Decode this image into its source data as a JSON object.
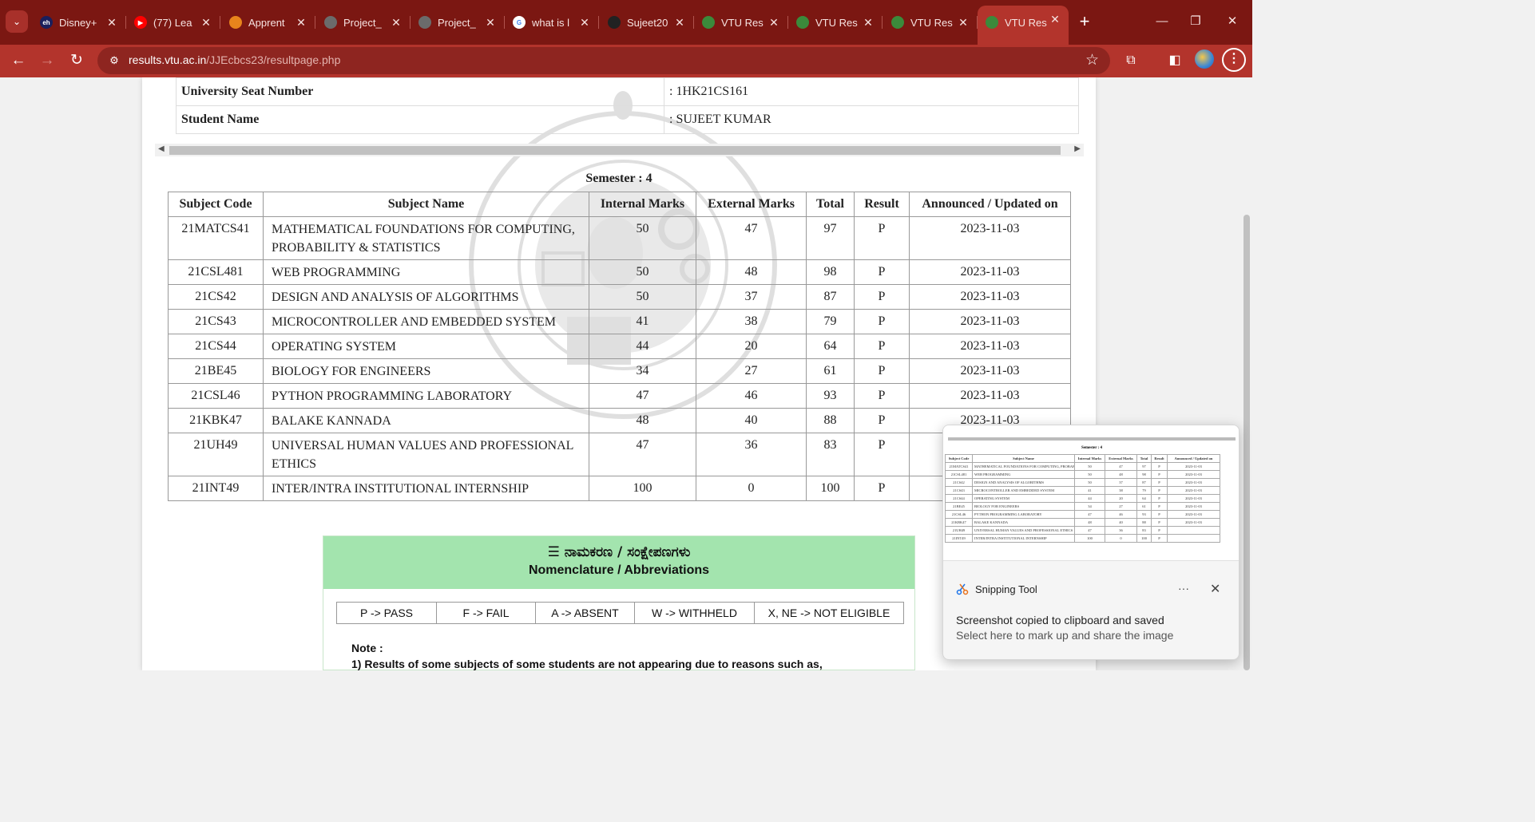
{
  "browser": {
    "tabs": [
      {
        "title": "Disney+",
        "favicon": "disney-hotstar-icon",
        "color": "#1a1f5c",
        "glyph": "eh"
      },
      {
        "title": "(77) Lea",
        "favicon": "youtube-icon",
        "color": "#ff0000",
        "glyph": "▶"
      },
      {
        "title": "Apprent",
        "favicon": "apprenticeship-icon",
        "color": "#e8841c",
        "glyph": ""
      },
      {
        "title": "Project_",
        "favicon": "globe-icon",
        "color": "#6b6b6b",
        "glyph": ""
      },
      {
        "title": "Project_",
        "favicon": "globe-icon",
        "color": "#6b6b6b",
        "glyph": ""
      },
      {
        "title": "what is l",
        "favicon": "google-icon",
        "color": "#ffffff",
        "glyph": "G"
      },
      {
        "title": "Sujeet20",
        "favicon": "github-icon",
        "color": "#222222",
        "glyph": ""
      },
      {
        "title": "VTU Res",
        "favicon": "vtu-icon",
        "color": "#3b8a3b",
        "glyph": ""
      },
      {
        "title": "VTU Res",
        "favicon": "vtu-icon",
        "color": "#3b8a3b",
        "glyph": ""
      },
      {
        "title": "VTU Res",
        "favicon": "vtu-icon",
        "color": "#3b8a3b",
        "glyph": ""
      },
      {
        "title": "VTU Res",
        "favicon": "vtu-icon",
        "color": "#3b8a3b",
        "glyph": "",
        "active": true
      }
    ],
    "url_host": "results.vtu.ac.in",
    "url_path": "/JJEcbcs23/resultpage.php"
  },
  "student": {
    "usn_label": "University Seat Number",
    "usn_value": ": 1HK21CS161",
    "name_label": "Student Name",
    "name_value": ": SUJEET KUMAR"
  },
  "semester": "Semester : 4",
  "marks_table": {
    "headers": [
      "Subject Code",
      "Subject Name",
      "Internal Marks",
      "External Marks",
      "Total",
      "Result",
      "Announced / Updated on"
    ],
    "rows": [
      {
        "code": "21MATCS41",
        "name": "MATHEMATICAL FOUNDATIONS FOR COMPUTING, PROBABILITY & STATISTICS",
        "internal": "50",
        "external": "47",
        "total": "97",
        "result": "P",
        "date": "2023-11-03"
      },
      {
        "code": "21CSL481",
        "name": "WEB PROGRAMMING",
        "internal": "50",
        "external": "48",
        "total": "98",
        "result": "P",
        "date": "2023-11-03"
      },
      {
        "code": "21CS42",
        "name": "DESIGN AND ANALYSIS OF ALGORITHMS",
        "internal": "50",
        "external": "37",
        "total": "87",
        "result": "P",
        "date": "2023-11-03"
      },
      {
        "code": "21CS43",
        "name": "MICROCONTROLLER AND EMBEDDED SYSTEM",
        "internal": "41",
        "external": "38",
        "total": "79",
        "result": "P",
        "date": "2023-11-03"
      },
      {
        "code": "21CS44",
        "name": "OPERATING SYSTEM",
        "internal": "44",
        "external": "20",
        "total": "64",
        "result": "P",
        "date": "2023-11-03"
      },
      {
        "code": "21BE45",
        "name": "BIOLOGY FOR ENGINEERS",
        "internal": "34",
        "external": "27",
        "total": "61",
        "result": "P",
        "date": "2023-11-03"
      },
      {
        "code": "21CSL46",
        "name": "PYTHON PROGRAMMING LABORATORY",
        "internal": "47",
        "external": "46",
        "total": "93",
        "result": "P",
        "date": "2023-11-03"
      },
      {
        "code": "21KBK47",
        "name": "BALAKE KANNADA",
        "internal": "48",
        "external": "40",
        "total": "88",
        "result": "P",
        "date": "2023-11-03"
      },
      {
        "code": "21UH49",
        "name": "UNIVERSAL HUMAN VALUES AND PROFESSIONAL ETHICS",
        "internal": "47",
        "external": "36",
        "total": "83",
        "result": "P",
        "date": ""
      },
      {
        "code": "21INT49",
        "name": "INTER/INTRA INSTITUTIONAL INTERNSHIP",
        "internal": "100",
        "external": "0",
        "total": "100",
        "result": "P",
        "date": ""
      }
    ]
  },
  "nomenclature": {
    "title_kn": "ನಾಮಕರಣ / ಸಂಕ್ಷೇಪಣಗಳು",
    "title_en": "Nomenclature / Abbreviations",
    "items": [
      "P -> PASS",
      "F -> FAIL",
      "A -> ABSENT",
      "W -> WITHHELD",
      "X, NE -> NOT ELIGIBLE"
    ],
    "note_label": "Note :",
    "note_1": "1) Results of some subjects of some students are not appearing due to reasons such as,"
  },
  "toast": {
    "app_name": "Snipping Tool",
    "message": "Screenshot copied to clipboard and saved",
    "sub": "Select here to mark up and share the image",
    "more": "···",
    "close": "✕"
  },
  "colors": {
    "tabstrip": "#7b1712",
    "toolbar": "#b3342c",
    "nomen_header": "#a3e4ae"
  }
}
